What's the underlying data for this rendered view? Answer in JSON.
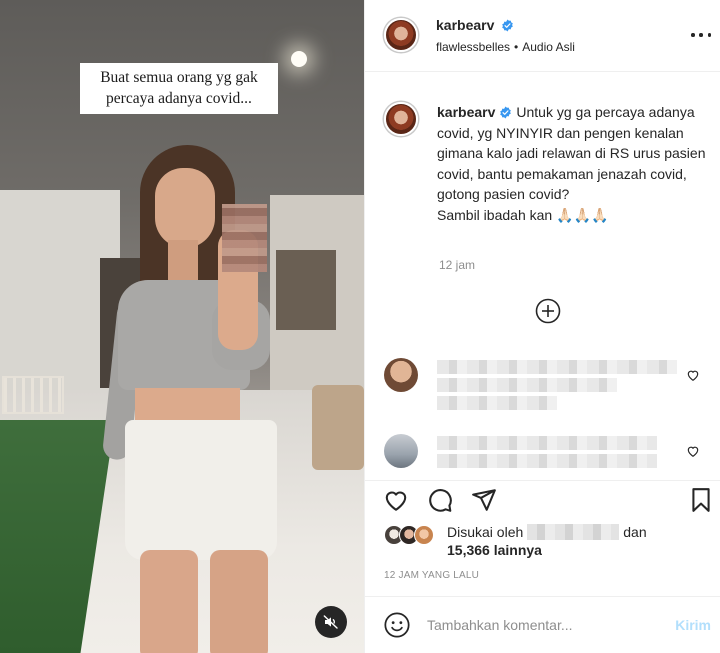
{
  "video": {
    "overlay_caption": "Buat semua orang yg gak percaya adanya covid...",
    "mute_icon": "speaker-muted-icon"
  },
  "header": {
    "username": "karbearv",
    "verified": true,
    "subtitle_user": "flawlessbelles",
    "subtitle_sep": "•",
    "audio": "Audio Asli",
    "more_icon": "more-options-icon"
  },
  "caption": {
    "username": "karbearv",
    "text": "Untuk yg ga percaya adanya covid, yg NYINYIR dan pengen kenalan gimana kalo jadi relawan di RS urus pasien covid, bantu pemakaman jenazah covid, gotong pasien covid?",
    "text2": "Sambil ibadah kan 🙏🏻🙏🏻🙏🏻",
    "time": "12 jam"
  },
  "load_more_icon": "plus-circle-icon",
  "comments": [
    {
      "avatar_color": "#c79a7b",
      "blurred": true
    },
    {
      "avatar_color": "#9aa3ad",
      "blurred": true
    }
  ],
  "actions": {
    "like_icon": "heart-icon",
    "comment_icon": "comment-icon",
    "share_icon": "paper-plane-icon",
    "save_icon": "bookmark-icon"
  },
  "likes": {
    "prefix": "Disukai oleh",
    "suffix": "dan",
    "count": "15,366 lainnya"
  },
  "posted_ago": "12 JAM YANG LALU",
  "add_comment": {
    "placeholder": "Tambahkan komentar...",
    "post_label": "Kirim"
  },
  "colors": {
    "verified_blue": "#3897f0",
    "post_disabled": "#b2dffc",
    "text": "#262626",
    "muted": "#8e8e8e"
  }
}
